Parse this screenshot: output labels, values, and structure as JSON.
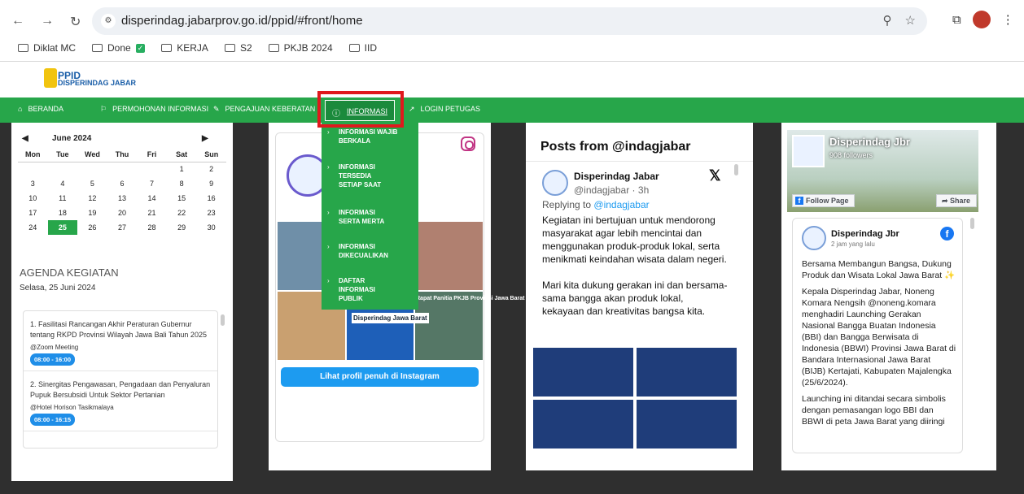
{
  "browser": {
    "url": "disperindag.jabarprov.go.id/ppid/#front/home",
    "bookmarks": [
      "Diklat MC",
      "Done",
      "KERJA",
      "S2",
      "PKJB 2024",
      "IID"
    ]
  },
  "site": {
    "logo_line1": "PPID",
    "logo_line2": "DISPERINDAG JABAR"
  },
  "nav": {
    "beranda": "BERANDA",
    "permohonan": "PERMOHONAN INFORMASI",
    "pengajuan": "PENGAJUAN KEBERATAN",
    "informasi": "INFORMASI",
    "login": "LOGIN PETUGAS"
  },
  "menu": {
    "items": [
      "INFORMASI WAJIB BERKALA",
      "INFORMASI TERSEDIA SETIAP SAAT",
      "INFORMASI SERTA MERTA",
      "INFORMASI DIKECUALIKAN",
      "DAFTAR INFORMASI PUBLIK"
    ]
  },
  "calendar": {
    "month": "June 2024",
    "days": [
      "Mon",
      "Tue",
      "Wed",
      "Thu",
      "Fri",
      "Sat",
      "Sun"
    ],
    "weeks": [
      [
        "",
        "",
        "",
        "",
        "",
        "1",
        "2"
      ],
      [
        "3",
        "4",
        "5",
        "6",
        "7",
        "8",
        "9"
      ],
      [
        "10",
        "11",
        "12",
        "13",
        "14",
        "15",
        "16"
      ],
      [
        "17",
        "18",
        "19",
        "20",
        "21",
        "22",
        "23"
      ],
      [
        "24",
        "25",
        "26",
        "27",
        "28",
        "29",
        "30"
      ]
    ],
    "today": "25"
  },
  "agenda": {
    "title": "AGENDA KEGIATAN",
    "date": "Selasa, 25 Juni 2024",
    "items": [
      {
        "title": "1. Fasilitasi Rancangan Akhir Peraturan Gubernur tentang RKPD Provinsi Wilayah Jawa Bali Tahun 2025",
        "location": "@Zoom Meeting",
        "time": "08:00 - 16:00"
      },
      {
        "title": "2. Sinergitas Pengawasan, Pengadaan dan Penyaluran Pupuk Bersubsidi Untuk Sektor Pertanian",
        "location": "@Hotel Horison Tasikmalaya",
        "time": "08:00 - 16:15"
      }
    ]
  },
  "instagram": {
    "button": "Lihat profil penuh di Instagram",
    "post_label": "Disperindag Jawa Barat",
    "post_caption": "Rapat Panitia PKJB Provinsi Jawa Barat"
  },
  "twitter": {
    "title": "Posts from @indagjabar",
    "name": "Disperindag Jabar",
    "handle": "@indagjabar · 3h",
    "replying_prefix": "Replying to",
    "replying_to": "@indagjabar",
    "para1": "Kegiatan ini bertujuan untuk mendorong masyarakat agar lebih mencintai dan menggunakan produk-produk lokal, serta menikmati keindahan wisata dalam negeri.",
    "para2": "Mari kita dukung gerakan ini dan bersama-sama bangga akan produk lokal, kekayaan dan kreativitas bangsa kita."
  },
  "facebook": {
    "page_name": "Disperindag Jbr",
    "followers": "908 followers",
    "follow_btn": "Follow Page",
    "share_btn": "Share",
    "post_name": "Disperindag Jbr",
    "post_time": "2 jam yang lalu",
    "para1": "Bersama Membangun Bangsa, Dukung Produk dan Wisata Lokal Jawa Barat ✨",
    "para2": "Kepala Disperindag Jabar, Noneng Komara Nengsih @noneng.komara menghadiri Launching Gerakan Nasional Bangga Buatan Indonesia (BBI) dan Bangga Berwisata di Indonesia (BBWI) Provinsi Jawa Barat di Bandara Internasional Jawa Barat (BIJB) Kertajati, Kabupaten Majalengka (25/6/2024).",
    "para3": "Launching ini ditandai secara simbolis dengan pemasangan logo BBI dan BBWI di peta Jawa Barat yang diiringi"
  }
}
